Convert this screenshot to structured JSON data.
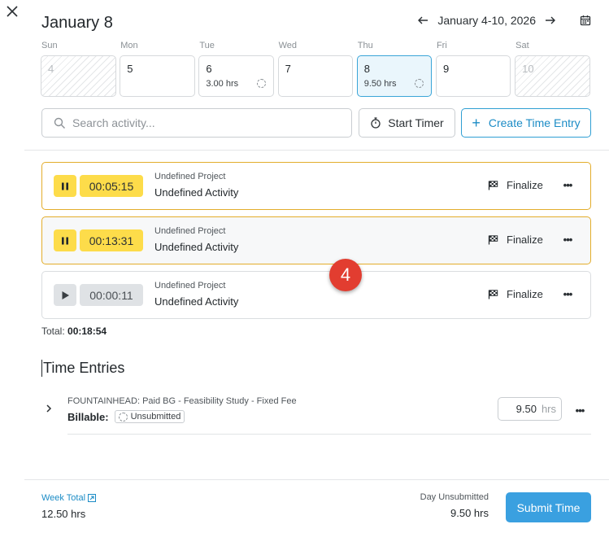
{
  "header": {
    "day_title": "January 8",
    "week_range": "January 4-10, 2026"
  },
  "week": [
    {
      "name": "Sun",
      "num": "4",
      "hours": "",
      "weekend": true
    },
    {
      "name": "Mon",
      "num": "5",
      "hours": ""
    },
    {
      "name": "Tue",
      "num": "6",
      "hours": "3.00 hrs"
    },
    {
      "name": "Wed",
      "num": "7",
      "hours": ""
    },
    {
      "name": "Thu",
      "num": "8",
      "hours": "9.50 hrs",
      "selected": true
    },
    {
      "name": "Fri",
      "num": "9",
      "hours": ""
    },
    {
      "name": "Sat",
      "num": "10",
      "hours": "",
      "weekend": true
    }
  ],
  "toolbar": {
    "search_placeholder": "Search activity...",
    "start_timer_label": "Start Timer",
    "create_entry_label": "Create Time Entry"
  },
  "timers": [
    {
      "elapsed": "00:05:15",
      "project": "Undefined Project",
      "activity": "Undefined Activity",
      "state": "running",
      "finalize_label": "Finalize"
    },
    {
      "elapsed": "00:13:31",
      "project": "Undefined Project",
      "activity": "Undefined Activity",
      "state": "running",
      "finalize_label": "Finalize"
    },
    {
      "elapsed": "00:00:11",
      "project": "Undefined Project",
      "activity": "Undefined Activity",
      "state": "stopped",
      "finalize_label": "Finalize"
    }
  ],
  "timers_total": {
    "label": "Total:",
    "value": "00:18:54"
  },
  "step_badge": "4",
  "time_entries": {
    "title": "Time Entries",
    "items": [
      {
        "description": "FOUNTAINHEAD: Paid BG - Feasibility Study - Fixed Fee",
        "billable_label": "Billable:",
        "status": "Unsubmitted",
        "hours": "9.50",
        "unit": "hrs"
      }
    ]
  },
  "footer": {
    "week_total_label": "Week Total",
    "week_total_value": "12.50 hrs",
    "day_unsubmitted_label": "Day Unsubmitted",
    "day_unsubmitted_value": "9.50 hrs",
    "submit_label": "Submit Time"
  },
  "colors": {
    "accent": "#3aa0e0",
    "running_timer": "#fddc4a",
    "running_border": "#e3ad2b",
    "badge": "#e23d30"
  }
}
